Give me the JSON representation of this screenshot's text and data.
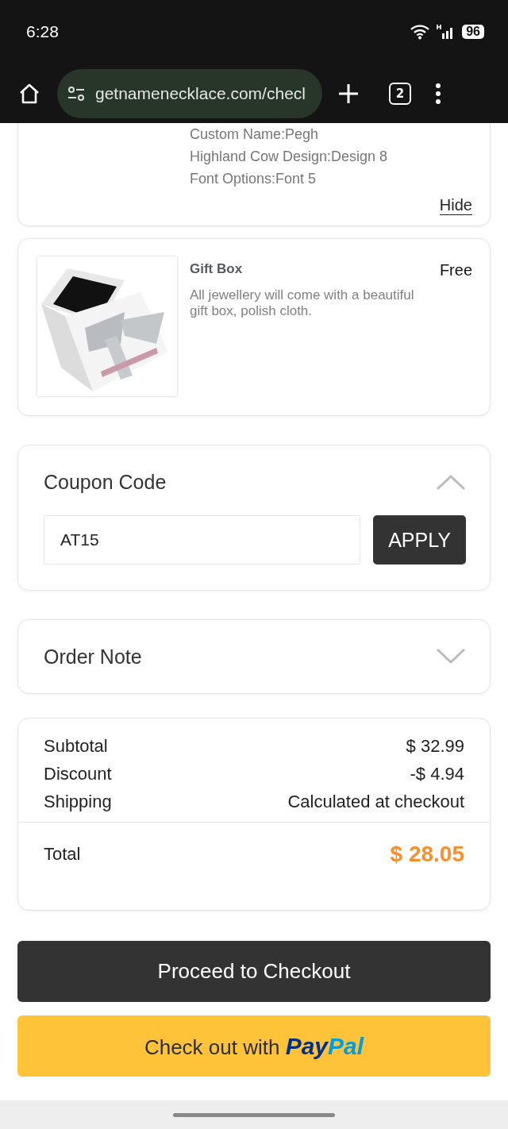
{
  "status_bar": {
    "time": "6:28",
    "battery": "96"
  },
  "browser": {
    "url": "getnamenecklace.com/checl",
    "tab_count": "2"
  },
  "product_card": {
    "options": [
      "Custom Name:Pegh",
      "Highland Cow Design:Design 8",
      "Font Options:Font 5"
    ],
    "toggle": "Hide"
  },
  "gift_card": {
    "title": "Gift Box",
    "price": "Free",
    "description": "All jewellery will come with a beautiful gift box, polish cloth."
  },
  "coupon": {
    "title": "Coupon Code",
    "expanded": true,
    "value": "AT15",
    "button": "APPLY"
  },
  "order_note": {
    "title": "Order Note",
    "expanded": false
  },
  "summary": {
    "rows": [
      {
        "label": "Subtotal",
        "value": "$ 32.99"
      },
      {
        "label": "Discount",
        "value": "-$ 4.94"
      },
      {
        "label": "Shipping",
        "value": "Calculated at checkout"
      }
    ],
    "total": {
      "label": "Total",
      "value": "$ 28.05"
    }
  },
  "checkout_button": "Proceed to Checkout",
  "paypal_button": {
    "text": "Check out with",
    "logo": [
      "Pay",
      "Pal"
    ]
  }
}
